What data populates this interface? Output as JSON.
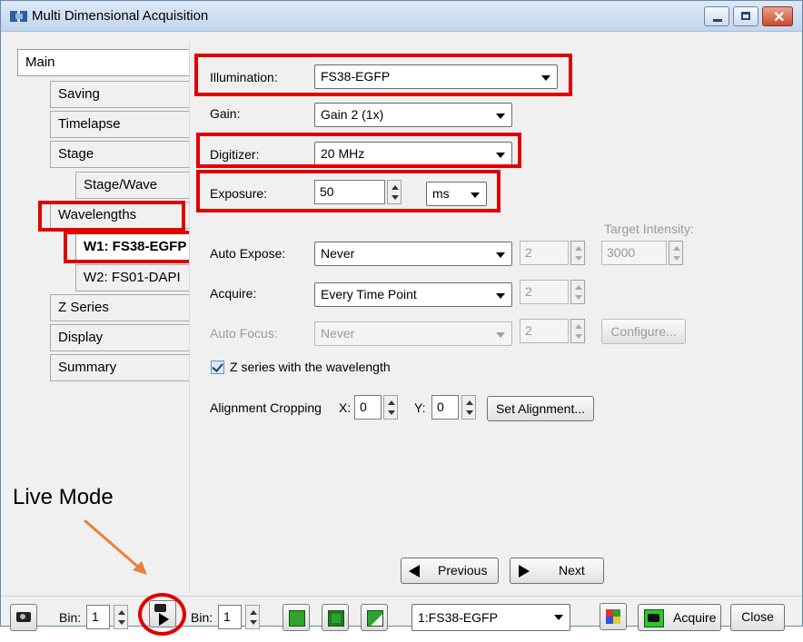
{
  "window": {
    "title": "Multi Dimensional Acquisition"
  },
  "nav": {
    "items": [
      {
        "label": "Main"
      },
      {
        "label": "Saving"
      },
      {
        "label": "Timelapse"
      },
      {
        "label": "Stage"
      },
      {
        "label": "Stage/Wave"
      },
      {
        "label": "Wavelengths"
      },
      {
        "label": "W1: FS38-EGFP"
      },
      {
        "label": "W2: FS01-DAPI"
      },
      {
        "label": "Z Series"
      },
      {
        "label": "Display"
      },
      {
        "label": "Summary"
      }
    ]
  },
  "form": {
    "illumination_label": "Illumination:",
    "illumination_value": "FS38-EGFP",
    "gain_label": "Gain:",
    "gain_value": "Gain 2 (1x)",
    "digitizer_label": "Digitizer:",
    "digitizer_value": "20 MHz",
    "exposure_label": "Exposure:",
    "exposure_value": "50",
    "exposure_unit": "ms",
    "target_intensity_label": "Target Intensity:",
    "auto_expose_label": "Auto Expose:",
    "auto_expose_value": "Never",
    "auto_expose_number": "2",
    "target_intensity_value": "3000",
    "acquire_label": "Acquire:",
    "acquire_value": "Every Time Point",
    "acquire_number": "2",
    "auto_focus_label": "Auto Focus:",
    "auto_focus_value": "Never",
    "auto_focus_number": "2",
    "configure_label": "Configure...",
    "z_series_checkbox_label": "Z series with the wavelength",
    "z_series_checked": true,
    "alignment_label": "Alignment Cropping",
    "x_label": "X:",
    "x_value": "0",
    "y_label": "Y:",
    "y_value": "0",
    "set_alignment_label": "Set Alignment..."
  },
  "navigation": {
    "previous_label": "Previous",
    "next_label": "Next"
  },
  "bottom_bar": {
    "bin1_label": "Bin:",
    "bin1_value": "1",
    "bin2_label": "Bin:",
    "bin2_value": "1",
    "wavelength_select_value": "1:FS38-EGFP",
    "acquire_label": "Acquire",
    "close_label": "Close"
  },
  "annotation": {
    "live_mode_label": "Live Mode"
  },
  "colors": {
    "highlight": "#e00000",
    "arrow": "#e8823a",
    "title_bar": "#c9daf0"
  }
}
